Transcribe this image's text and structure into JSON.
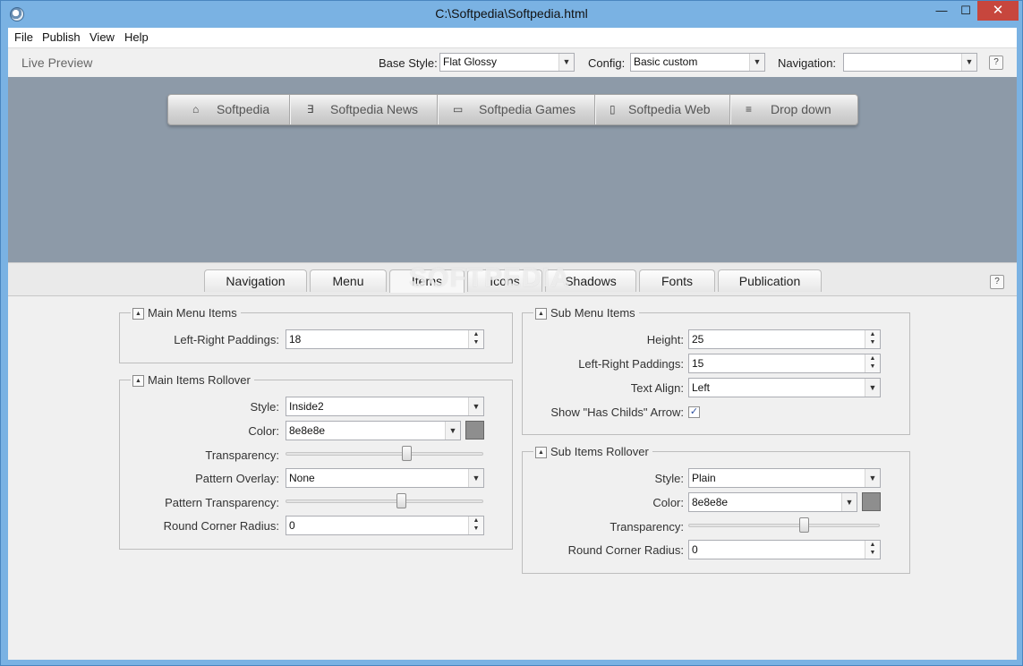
{
  "window": {
    "title": "C:\\Softpedia\\Softpedia.html",
    "minimize": "—",
    "maximize": "☐",
    "close": "✕"
  },
  "menu": [
    "File",
    "Publish",
    "View",
    "Help"
  ],
  "toolbar": {
    "live_preview": "Live Preview",
    "base_style_label": "Base Style:",
    "base_style_value": "Flat Glossy",
    "config_label": "Config:",
    "config_value": "Basic custom",
    "navigation_label": "Navigation:",
    "navigation_value": "",
    "help": "?"
  },
  "preview": {
    "nav_items": [
      {
        "icon": "home-icon",
        "glyph": "⌂",
        "label": "Softpedia"
      },
      {
        "icon": "css3-icon",
        "glyph": "∃",
        "label": "Softpedia News"
      },
      {
        "icon": "monitor-icon",
        "glyph": "▭",
        "label": "Softpedia Games"
      },
      {
        "icon": "mobile-icon",
        "glyph": "▯",
        "label": "Softpedia Web"
      },
      {
        "icon": "list-icon",
        "glyph": "≡",
        "label": "Drop down"
      }
    ]
  },
  "tabs": [
    "Navigation",
    "Menu",
    "Items",
    "Icons",
    "Shadows",
    "Fonts",
    "Publication"
  ],
  "active_tab": "Items",
  "watermark": "SOFTPEDIA",
  "main_menu_items": {
    "title": "Main Menu Items",
    "paddings_label": "Left-Right Paddings:",
    "paddings_value": "18"
  },
  "main_items_rollover": {
    "title": "Main Items Rollover",
    "style_label": "Style:",
    "style_value": "Inside2",
    "color_label": "Color:",
    "color_value": "8e8e8e",
    "transparency_label": "Transparency:",
    "transparency_level": 0.62,
    "pattern_overlay_label": "Pattern Overlay:",
    "pattern_overlay_value": "None",
    "pattern_transparency_label": "Pattern Transparency:",
    "pattern_transparency_level": 0.59,
    "radius_label": "Round Corner Radius:",
    "radius_value": "0"
  },
  "sub_menu_items": {
    "title": "Sub Menu Items",
    "height_label": "Height:",
    "height_value": "25",
    "paddings_label": "Left-Right Paddings:",
    "paddings_value": "15",
    "text_align_label": "Text Align:",
    "text_align_value": "Left",
    "arrow_label": "Show \"Has Childs\" Arrow:",
    "arrow_checked": "✓"
  },
  "sub_items_rollover": {
    "title": "Sub Items Rollover",
    "style_label": "Style:",
    "style_value": "Plain",
    "color_label": "Color:",
    "color_value": "8e8e8e",
    "transparency_label": "Transparency:",
    "transparency_level": 0.61,
    "radius_label": "Round Corner Radius:",
    "radius_value": "0"
  },
  "colors": {
    "swatch": "#8e8e8e",
    "preview_bg": "#8d9aa8",
    "title_bar": "#7ab2e3"
  }
}
